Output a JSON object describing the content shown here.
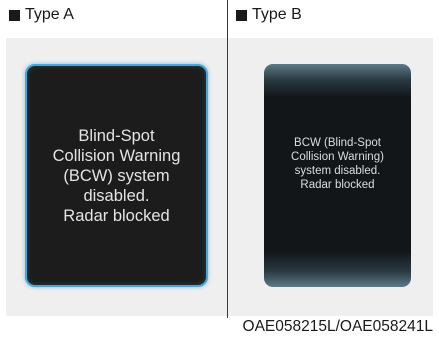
{
  "type_a": {
    "label": "Type A",
    "message": "Blind-Spot\nCollision Warning\n(BCW) system\ndisabled.\nRadar blocked"
  },
  "type_b": {
    "label": "Type B",
    "message": "BCW (Blind-Spot\nCollision Warning)\nsystem disabled.\nRadar blocked"
  },
  "figure_code": "OAE058215L/OAE058241L",
  "colors": {
    "frame_a_border": "#4aa6d6",
    "screen_bg": "#1c1c1c"
  }
}
